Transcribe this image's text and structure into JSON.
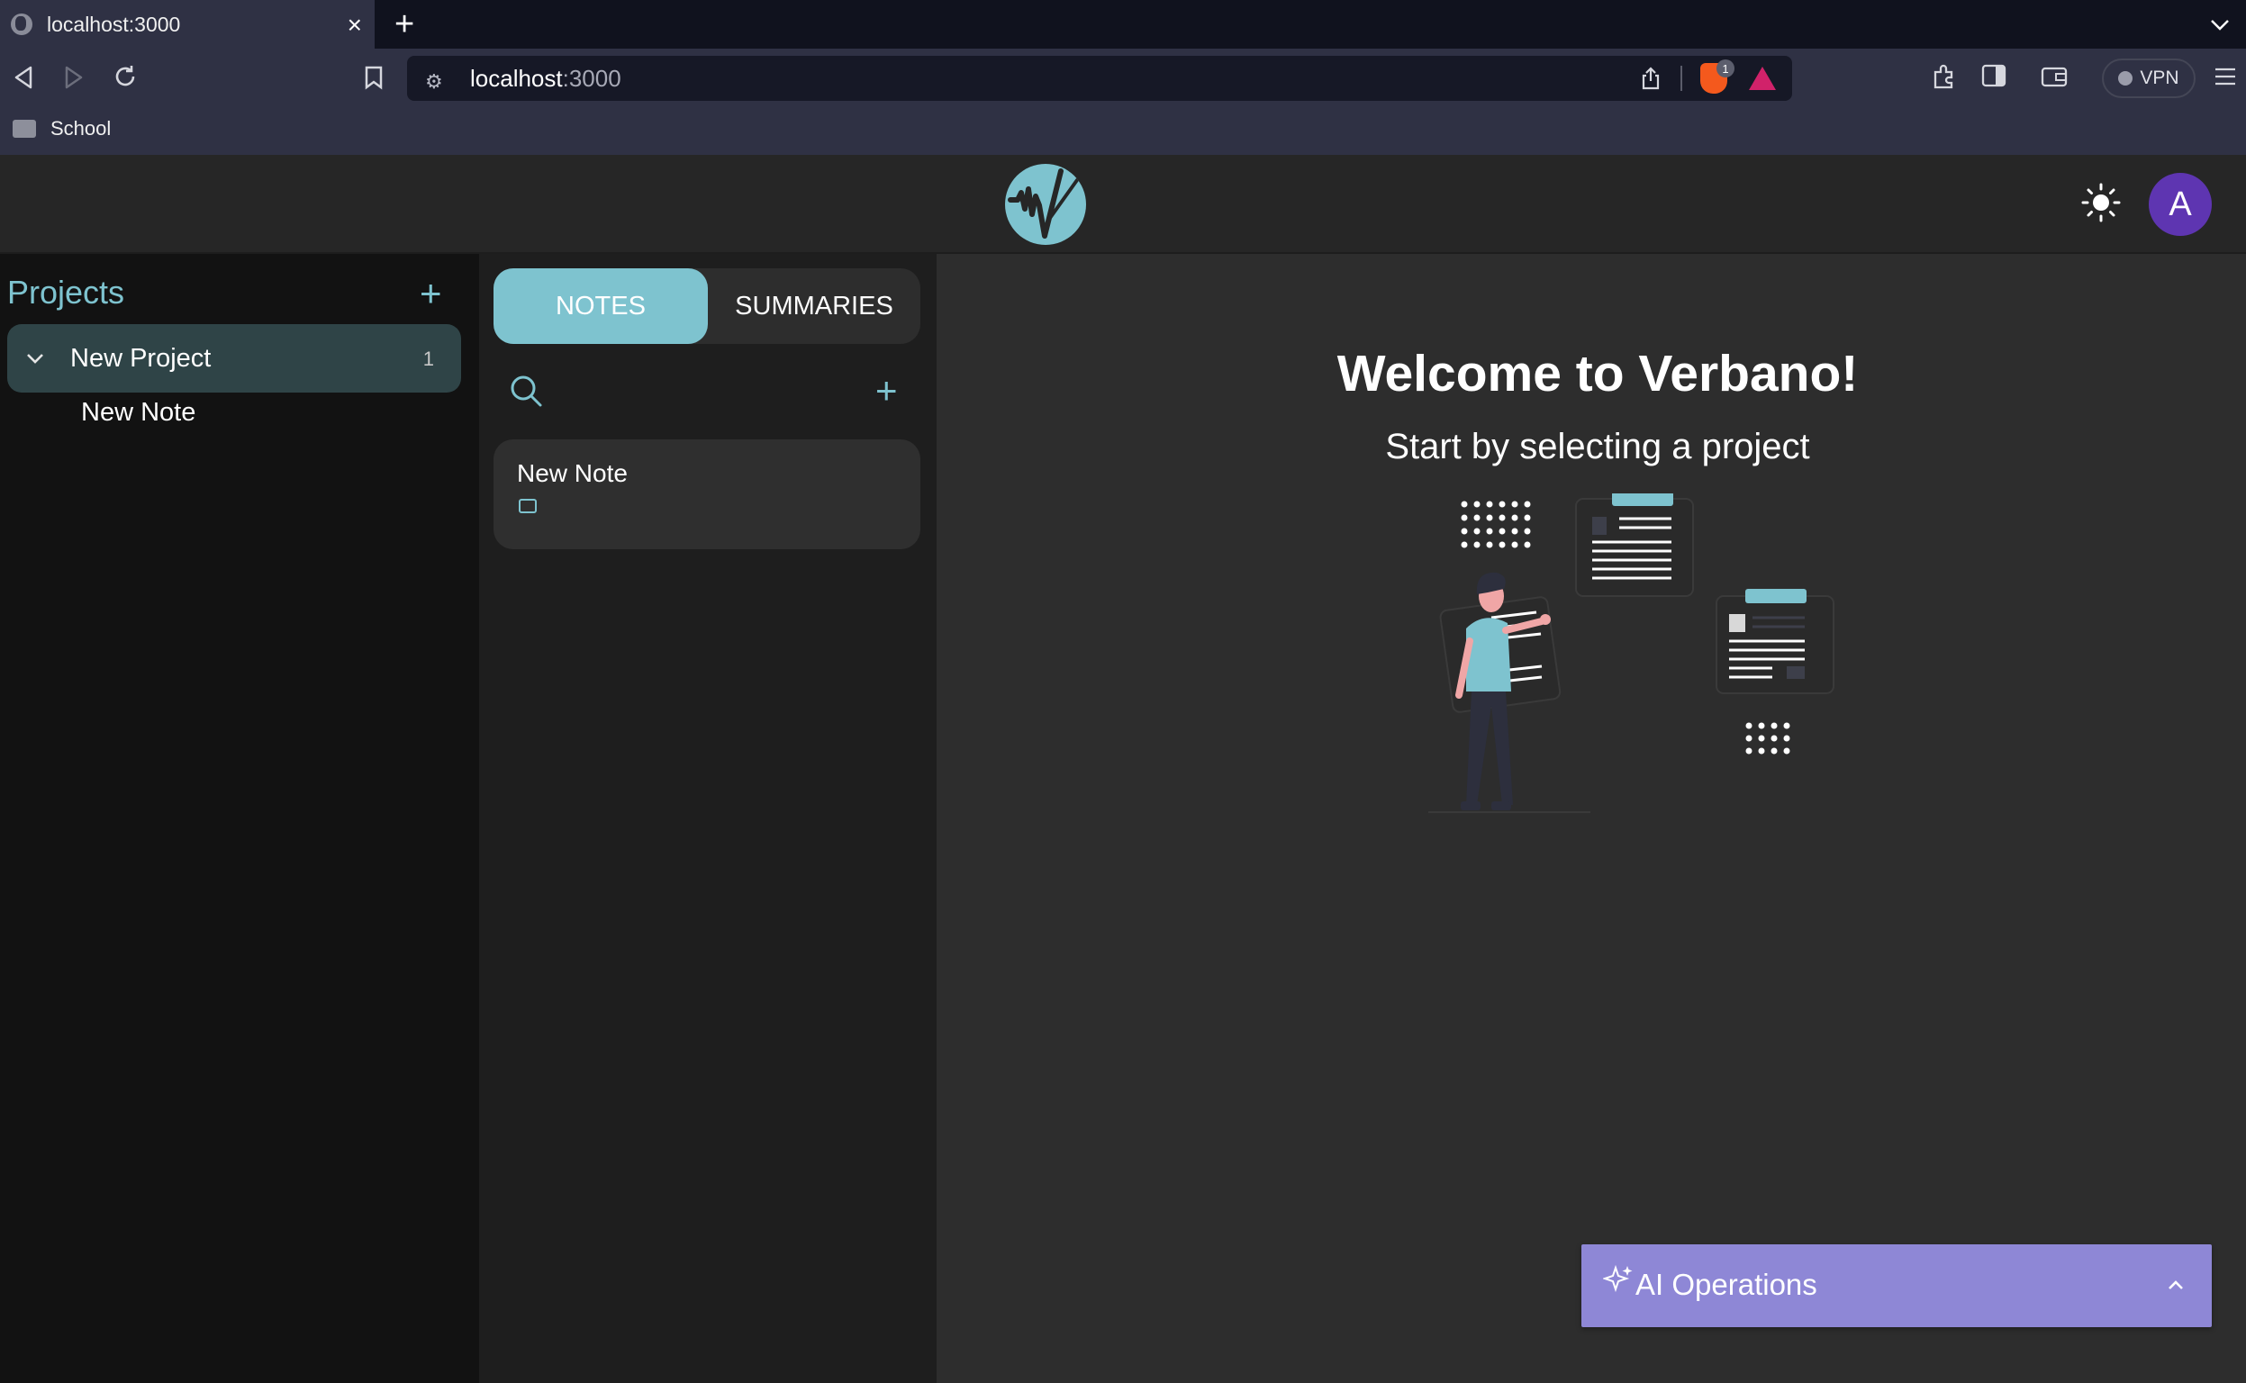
{
  "browser": {
    "tab_title": "localhost:3000",
    "tab_close": "×",
    "new_tab": "+",
    "url_host": "localhost",
    "url_port": ":3000",
    "vpn_label": "VPN",
    "shields_count": "1",
    "bookmark_folder": "School"
  },
  "header": {
    "avatar_initial": "A"
  },
  "sidebar": {
    "title": "Projects",
    "add": "+",
    "project": {
      "name": "New Project",
      "count": "1"
    },
    "note": "New Note"
  },
  "notes": {
    "tab_notes": "NOTES",
    "tab_summaries": "SUMMARIES",
    "add": "+",
    "items": [
      {
        "title": "New Note"
      }
    ]
  },
  "main": {
    "welcome": "Welcome to Verbano!",
    "subtitle": "Start by selecting a project"
  },
  "ai_panel": {
    "label": "AI Operations"
  },
  "colors": {
    "accent": "#7ec3cf",
    "avatar": "#5e35b1",
    "ai_panel": "#8e87d6"
  }
}
